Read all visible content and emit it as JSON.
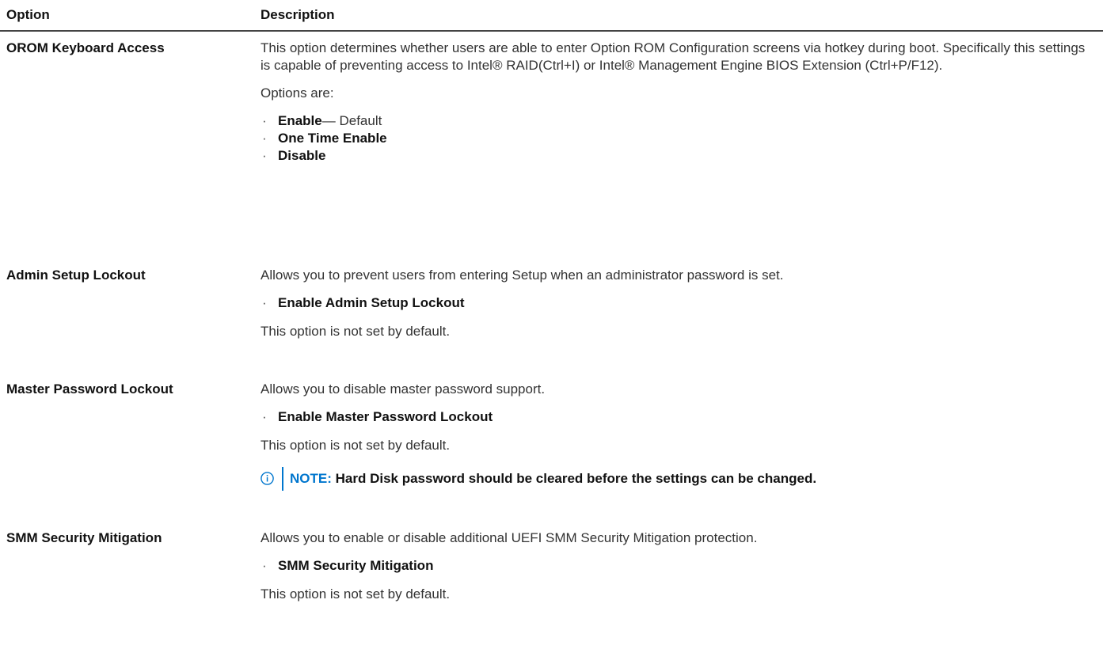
{
  "header": {
    "option": "Option",
    "description": "Description"
  },
  "rows": [
    {
      "option": "OROM Keyboard Access",
      "description": "This option determines whether users are able to enter Option ROM Configuration screens via hotkey during boot. Specifically this settings is capable of preventing access to Intel® RAID(Ctrl+I) or Intel® Management Engine BIOS Extension (Ctrl+P/F12).",
      "options_label": "Options are:",
      "items": [
        {
          "label": "Enable",
          "suffix": "— Default"
        },
        {
          "label": "One Time Enable"
        },
        {
          "label": "Disable"
        }
      ]
    },
    {
      "option": "Admin Setup Lockout",
      "description": "Allows you to prevent users from entering Setup when an administrator password is set.",
      "items": [
        {
          "label": "Enable Admin Setup Lockout"
        }
      ],
      "default_text": "This option is not set by default."
    },
    {
      "option": "Master Password Lockout",
      "description": "Allows you to disable master password support.",
      "items": [
        {
          "label": "Enable Master Password Lockout"
        }
      ],
      "default_text": "This option is not set by default.",
      "note_label": "NOTE:",
      "note_text": " Hard Disk password should be cleared before the settings can be changed."
    },
    {
      "option": "SMM Security Mitigation",
      "description": "Allows you to enable or disable additional UEFI SMM Security Mitigation protection.",
      "items": [
        {
          "label": "SMM Security Mitigation"
        }
      ],
      "default_text": "This option is not set by default."
    }
  ],
  "colors": {
    "note_accent": "#0076ce",
    "text": "#333333",
    "heading": "#111111"
  },
  "icons": {
    "note": "info-circle-icon",
    "bullet": "bullet-dot"
  }
}
